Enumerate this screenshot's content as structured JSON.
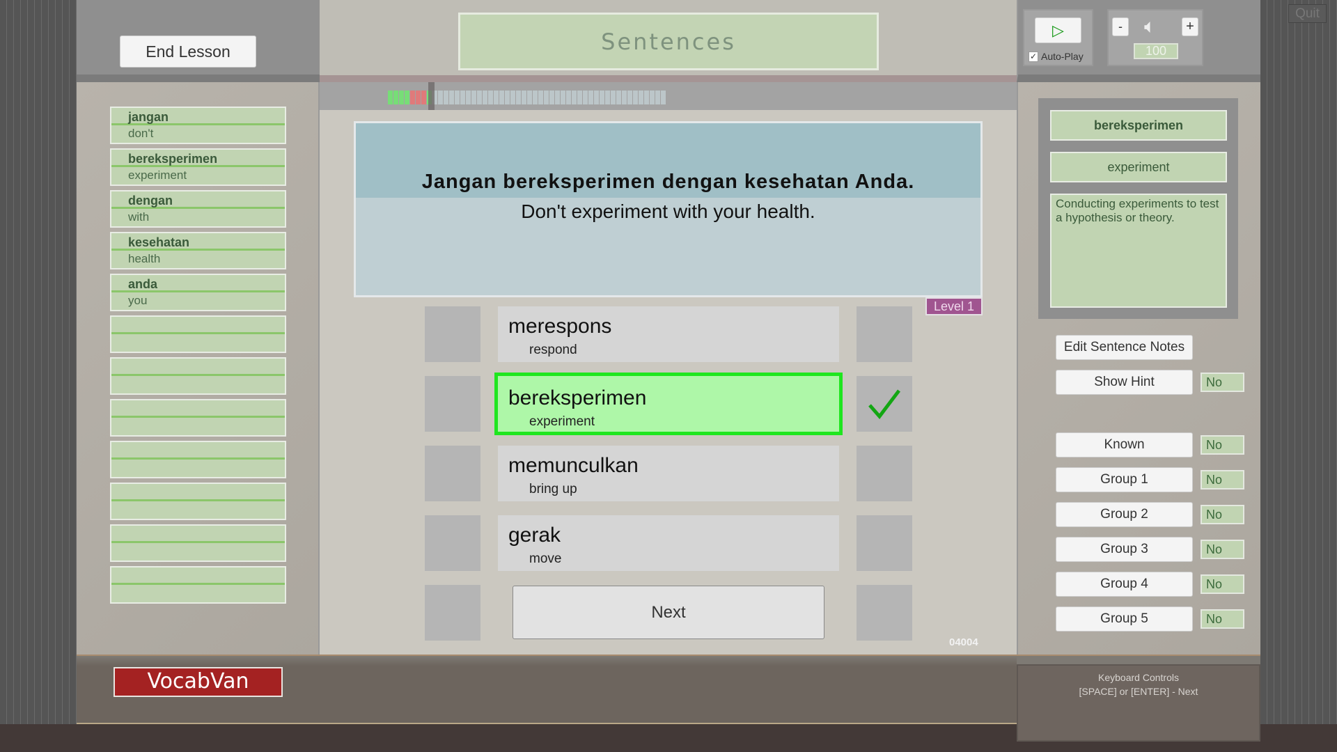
{
  "header": {
    "end_lesson": "End Lesson",
    "mode_title": "Sentences",
    "quit": "Quit"
  },
  "audio": {
    "play_icon": "play-icon",
    "autoplay_label": "Auto-Play",
    "autoplay_checked": true,
    "vol_minus": "-",
    "vol_plus": "+",
    "volume": "100"
  },
  "progress": {
    "total": 50,
    "results": [
      "correct",
      "correct",
      "correct",
      "correct",
      "wrong",
      "wrong",
      "wrong",
      "correct"
    ],
    "current_index": 8,
    "colors": {
      "correct": "#77dd77",
      "wrong": "#e07a7a",
      "pending": "#bcc6c9"
    }
  },
  "sentence": {
    "text": "Jangan bereksperimen dengan kesehatan Anda.",
    "translation": "Don't experiment with your health.",
    "level": "Level 1"
  },
  "words": [
    {
      "word": "jangan",
      "meaning": "don't"
    },
    {
      "word": "bereksperimen",
      "meaning": "experiment"
    },
    {
      "word": "dengan",
      "meaning": "with"
    },
    {
      "word": "kesehatan",
      "meaning": "health"
    },
    {
      "word": "anda",
      "meaning": "you"
    },
    {
      "word": "",
      "meaning": ""
    },
    {
      "word": "",
      "meaning": ""
    },
    {
      "word": "",
      "meaning": ""
    },
    {
      "word": "",
      "meaning": ""
    },
    {
      "word": "",
      "meaning": ""
    },
    {
      "word": "",
      "meaning": ""
    },
    {
      "word": "",
      "meaning": ""
    }
  ],
  "options": [
    {
      "word": "merespons",
      "meaning": "respond",
      "state": "normal"
    },
    {
      "word": "bereksperimen",
      "meaning": "experiment",
      "state": "correct"
    },
    {
      "word": "memunculkan",
      "meaning": "bring up",
      "state": "normal"
    },
    {
      "word": "gerak",
      "meaning": "move",
      "state": "normal"
    }
  ],
  "next_label": "Next",
  "counter": "04004",
  "detail": {
    "word": "bereksperimen",
    "meaning": "experiment",
    "note": "Conducting experiments to test a hypothesis or theory."
  },
  "side": {
    "edit_notes": "Edit Sentence Notes",
    "show_hint": "Show Hint",
    "show_hint_value": "No",
    "toggles": [
      {
        "label": "Known",
        "value": "No"
      },
      {
        "label": "Group 1",
        "value": "No"
      },
      {
        "label": "Group 2",
        "value": "No"
      },
      {
        "label": "Group 3",
        "value": "No"
      },
      {
        "label": "Group 4",
        "value": "No"
      },
      {
        "label": "Group 5",
        "value": "No"
      }
    ]
  },
  "footer": {
    "logo": "VocabVan",
    "kb_title": "Keyboard Controls",
    "kb_line": "[SPACE] or [ENTER] - Next"
  }
}
